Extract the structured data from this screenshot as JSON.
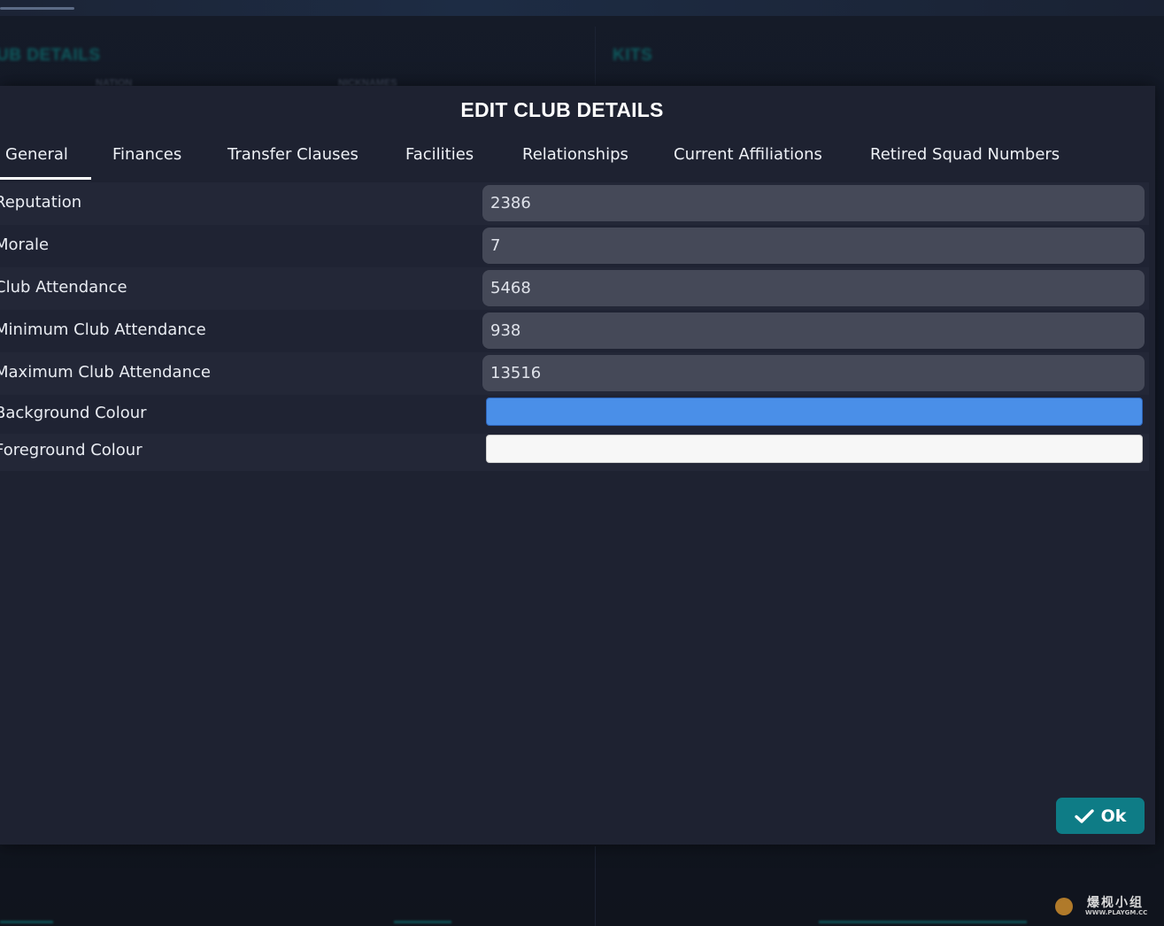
{
  "background": {
    "left_heading": "UB DETAILS",
    "right_heading": "KITS",
    "sub_left_1": "NATION",
    "sub_left_2": "NICKNAMES"
  },
  "dialog": {
    "title": "EDIT CLUB DETAILS",
    "tabs": [
      {
        "label": "General",
        "active": true
      },
      {
        "label": "Finances",
        "active": false
      },
      {
        "label": "Transfer Clauses",
        "active": false
      },
      {
        "label": "Facilities",
        "active": false
      },
      {
        "label": "Relationships",
        "active": false
      },
      {
        "label": "Current Affiliations",
        "active": false
      },
      {
        "label": "Retired Squad Numbers",
        "active": false
      }
    ],
    "fields": [
      {
        "label": "Reputation",
        "value": "2386"
      },
      {
        "label": "Morale",
        "value": "7"
      },
      {
        "label": "Club Attendance",
        "value": "5468"
      },
      {
        "label": "Minimum Club Attendance",
        "value": "938"
      },
      {
        "label": "Maximum Club Attendance",
        "value": "13516"
      }
    ],
    "colours": [
      {
        "label": "Background Colour",
        "color": "#4a8fe8"
      },
      {
        "label": "Foreground Colour",
        "color": "#f7f7f7"
      }
    ],
    "ok_label": "Ok",
    "ok_icon": "checkmark-icon"
  },
  "colors": {
    "dialog_bg": "#1e2231",
    "input_bg": "#454958",
    "accent": "#0e7c86"
  },
  "watermark": {
    "cn_text": "爆枧小组",
    "url_text": "WWW.PLAYGM.CC"
  }
}
